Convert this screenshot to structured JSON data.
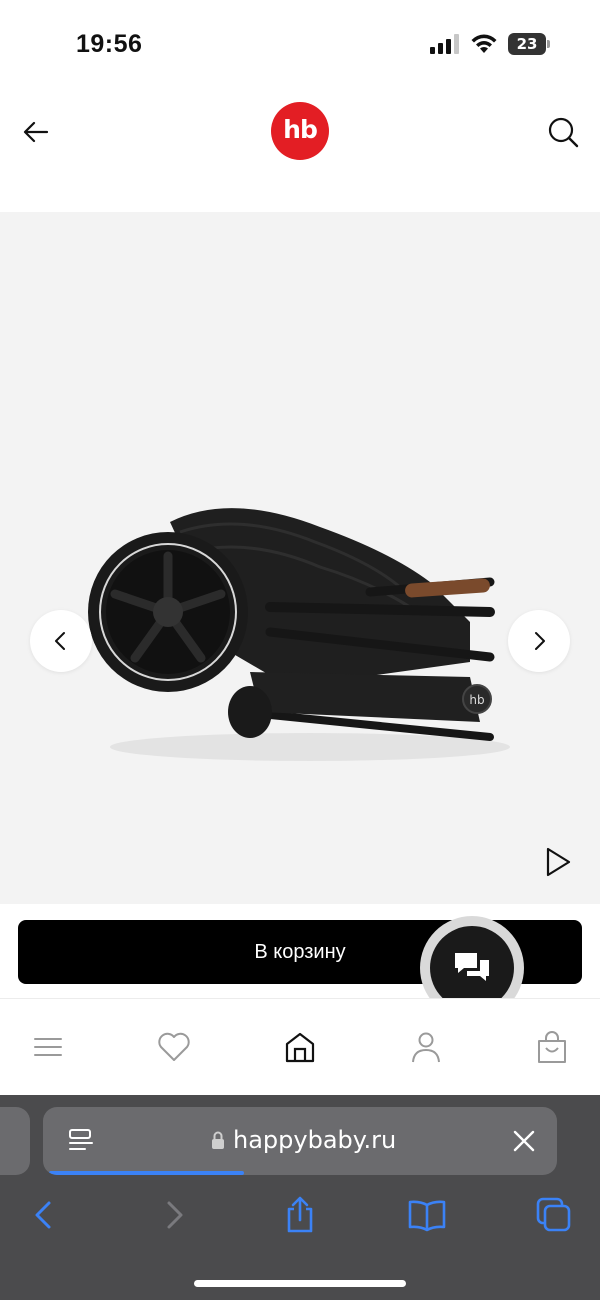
{
  "status_bar": {
    "time": "19:56",
    "battery_level": "23",
    "icons": [
      "signal-icon",
      "wifi-icon",
      "battery-icon"
    ]
  },
  "header": {
    "logo_text": "hb",
    "logo_color": "#e31e24",
    "icons": [
      "back-arrow-icon",
      "search-icon"
    ]
  },
  "gallery": {
    "image_subject": "folded stroller",
    "background_color": "#f3f3f3",
    "icons": [
      "chevron-left-icon",
      "chevron-right-icon",
      "play-icon"
    ]
  },
  "cart": {
    "button_label": "В корзину",
    "button_color": "#000000"
  },
  "chat": {
    "icon": "chat-bubbles-icon"
  },
  "bottom_nav": {
    "items": [
      {
        "name": "menu",
        "icon": "hamburger-menu-icon"
      },
      {
        "name": "favorites",
        "icon": "heart-icon"
      },
      {
        "name": "home",
        "icon": "home-icon",
        "active": true
      },
      {
        "name": "profile",
        "icon": "user-icon"
      },
      {
        "name": "cart",
        "icon": "shopping-bag-icon"
      }
    ]
  },
  "browser": {
    "url": "happybaby.ru",
    "load_progress": 0.39,
    "accent_color": "#3b82f6",
    "icons": [
      "page-menu-icon",
      "lock-icon",
      "close-icon",
      "back-icon",
      "forward-icon",
      "share-icon",
      "bookmarks-icon",
      "tabs-icon"
    ]
  }
}
